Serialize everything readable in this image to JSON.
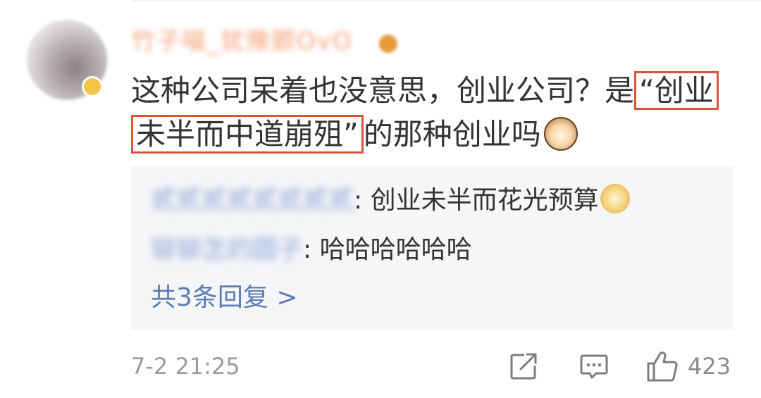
{
  "comment": {
    "username": "竹子喵_犹豫颤OvO",
    "content_before": "这种公司呆着也没意思，创业公司？是",
    "highlight_part1": "“创业",
    "highlight_part2": "未半而中道崩殂”",
    "content_after": "的那种创业吗",
    "content_emoji": "cat-face-emoji"
  },
  "replies": [
    {
      "name": "贰贰贰贰贰贰贰贰",
      "text": ": 创业未半而花光预算",
      "emoji": "doge-emoji"
    },
    {
      "name": "铆铆怎的圆子",
      "text": ": 哈哈哈哈哈哈"
    }
  ],
  "more_replies": "共3条回复 >",
  "footer": {
    "time": "7-2 21:25",
    "share_icon": "share-icon",
    "comment_icon": "comment-icon",
    "like_icon": "thumbs-up-icon",
    "like_count": "423"
  },
  "colors": {
    "highlight_border": "#d9553a",
    "link": "#5b7bb5",
    "reply_bg": "#f5f6f8"
  }
}
